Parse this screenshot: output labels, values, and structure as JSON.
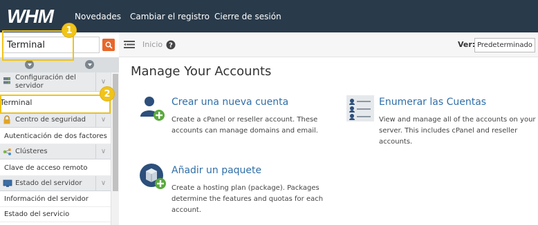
{
  "header": {
    "logo_text": "WHM",
    "nav": [
      "Novedades",
      "Cambiar el registro",
      "Cierre de sesión"
    ]
  },
  "sidebar": {
    "search_value": "Terminal",
    "categories": [
      {
        "label": "Configuración del servidor",
        "icon": "server-config-icon"
      },
      {
        "label": "Centro de seguridad",
        "icon": "lock-icon"
      },
      {
        "label": "Clústeres",
        "icon": "cluster-icon"
      },
      {
        "label": "Estado del servidor",
        "icon": "monitor-icon"
      }
    ],
    "items": [
      "Terminal",
      "Autenticación de dos factores",
      "Clave de acceso remoto",
      "Información del servidor",
      "Estado del servicio"
    ]
  },
  "breadcrumb": {
    "home": "Inicio",
    "ver_label": "Ver:",
    "ver_value": "Predeterminado"
  },
  "main": {
    "title": "Manage Your Accounts",
    "features": [
      {
        "title": "Crear una nueva cuenta",
        "desc": [
          "Create a cPanel or reseller account. These",
          "accounts can manage domains and email."
        ],
        "icon": "add-user-icon"
      },
      {
        "title": "Enumerar las Cuentas",
        "desc": [
          "View and manage all of the accounts on your",
          "server. This includes cPanel and reseller",
          "accounts."
        ],
        "icon": "account-list-icon"
      },
      {
        "title": "Añadir un paquete",
        "desc": [
          "Create a hosting plan (package). Packages",
          "determine the features and quotas for each",
          "account."
        ],
        "icon": "add-package-icon"
      }
    ]
  },
  "annotations": {
    "badges": [
      "1",
      "2"
    ]
  },
  "colors": {
    "topbar": "#293a4a",
    "link": "#2f6fa8",
    "accent_orange": "#e8672a",
    "highlight": "#f0c419"
  }
}
